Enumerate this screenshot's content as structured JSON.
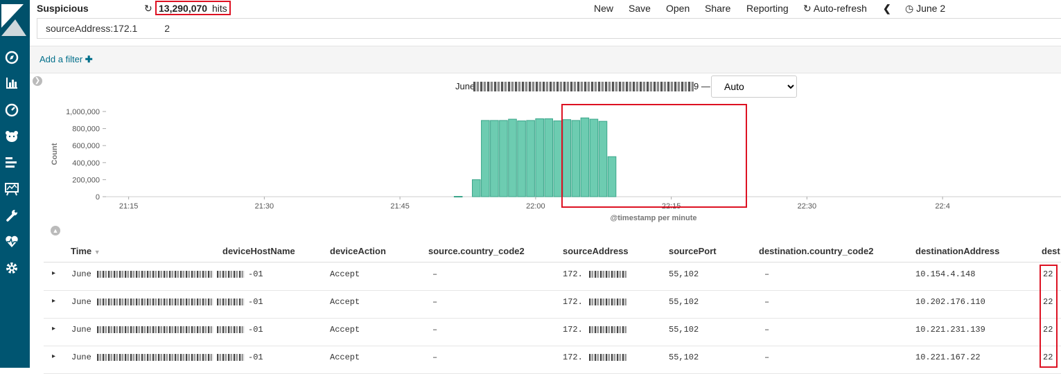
{
  "app": {
    "title": "Suspicious"
  },
  "hits": {
    "count": "13,290,070",
    "label": "hits"
  },
  "menu": {
    "new": "New",
    "save": "Save",
    "open": "Open",
    "share": "Share",
    "reporting": "Reporting",
    "auto_refresh": "Auto-refresh",
    "time_label": "June 2"
  },
  "search": {
    "value": "sourceAddress:172.1          2"
  },
  "filter": {
    "add_label": "Add a filter"
  },
  "time_range": {
    "start": "June",
    "end": "9 —"
  },
  "interval": {
    "selected": "Auto"
  },
  "chart_data": {
    "type": "bar",
    "ylabel": "Count",
    "xlabel": "@timestamp per minute",
    "ylim": [
      0,
      1000000
    ],
    "y_ticks": [
      "0",
      "200,000",
      "400,000",
      "600,000",
      "800,000",
      "1,000,000"
    ],
    "x_ticks": [
      "21:15",
      "21:30",
      "21:45",
      "22:00",
      "22:15",
      "22:30",
      "22:4"
    ],
    "x_tick_minutes": [
      75,
      90,
      105,
      120,
      135,
      150,
      165
    ],
    "bars": [
      {
        "minute": 111,
        "value": 4000
      },
      {
        "minute": 113,
        "value": 200000
      },
      {
        "minute": 114,
        "value": 895000
      },
      {
        "minute": 115,
        "value": 895000
      },
      {
        "minute": 116,
        "value": 895000
      },
      {
        "minute": 117,
        "value": 910000
      },
      {
        "minute": 118,
        "value": 890000
      },
      {
        "minute": 119,
        "value": 895000
      },
      {
        "minute": 120,
        "value": 915000
      },
      {
        "minute": 121,
        "value": 915000
      },
      {
        "minute": 122,
        "value": 890000
      },
      {
        "minute": 123,
        "value": 905000
      },
      {
        "minute": 124,
        "value": 895000
      },
      {
        "minute": 125,
        "value": 925000
      },
      {
        "minute": 126,
        "value": 910000
      },
      {
        "minute": 127,
        "value": 885000
      },
      {
        "minute": 128,
        "value": 470000
      }
    ],
    "bar_color": "#6dccb1"
  },
  "table": {
    "columns": [
      "Time",
      "deviceHostName",
      "deviceAction",
      "source.country_code2",
      "sourceAddress",
      "sourcePort",
      "destination.country_code2",
      "destinationAddress",
      "dest"
    ],
    "rows": [
      {
        "time": "June",
        "host": "-01",
        "action": "Accept",
        "country": "–",
        "src": "172.",
        "port": "55,102",
        "dcountry": "–",
        "dst": "10.154.4.148",
        "dport": "22"
      },
      {
        "time": "June",
        "host": "-01",
        "action": "Accept",
        "country": "–",
        "src": "172.",
        "port": "55,102",
        "dcountry": "–",
        "dst": "10.202.176.110",
        "dport": "22"
      },
      {
        "time": "June",
        "host": "-01",
        "action": "Accept",
        "country": "–",
        "src": "172.",
        "port": "55,102",
        "dcountry": "–",
        "dst": "10.221.231.139",
        "dport": "22"
      },
      {
        "time": "June",
        "host": "-01",
        "action": "Accept",
        "country": "–",
        "src": "172.",
        "port": "55,102",
        "dcountry": "–",
        "dst": "10.221.167.22",
        "dport": "22"
      }
    ]
  }
}
